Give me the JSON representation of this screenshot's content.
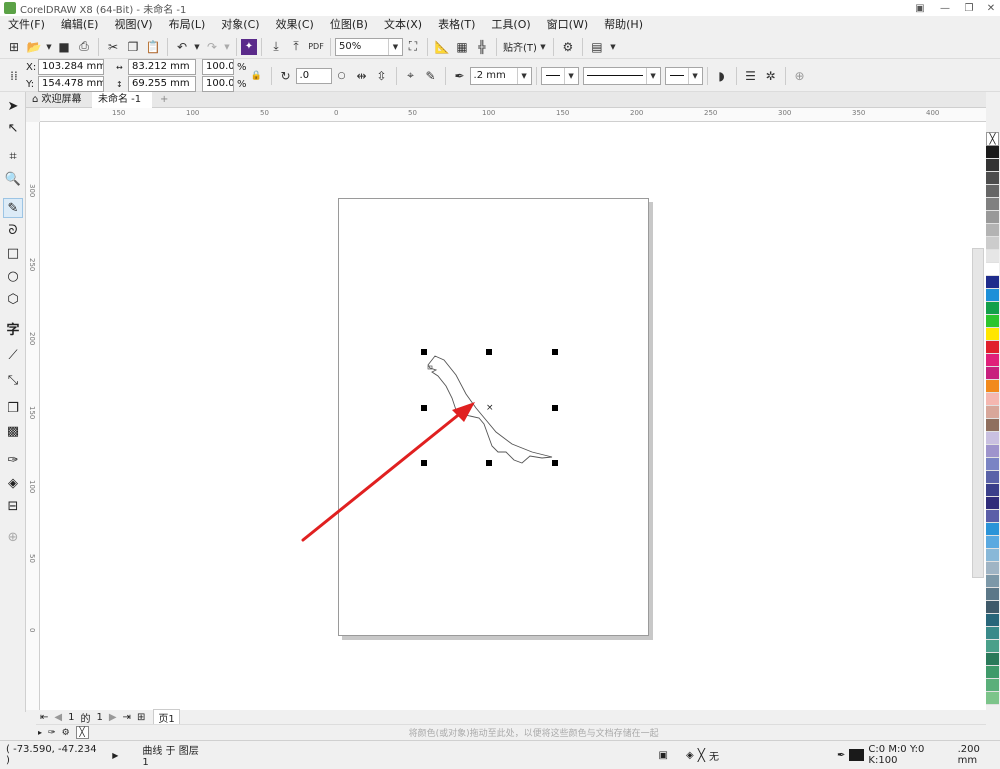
{
  "window": {
    "title": "CorelDRAW X8 (64-Bit) - 未命名 -1",
    "minimize": "—",
    "restore": "❐",
    "close": "✕"
  },
  "menu": [
    "文件(F)",
    "编辑(E)",
    "视图(V)",
    "布局(L)",
    "对象(C)",
    "效果(C)",
    "位图(B)",
    "文本(X)",
    "表格(T)",
    "工具(O)",
    "窗口(W)",
    "帮助(H)"
  ],
  "standard_toolbar": {
    "zoom": "50%",
    "snap_label": "贴齐(T)"
  },
  "property_bar": {
    "x_label": "X:",
    "x": "103.284 mm",
    "y_label": "Y:",
    "y": "154.478 mm",
    "width": "83.212 mm",
    "height": "69.255 mm",
    "scale_x": "100.0",
    "scale_y": "100.0",
    "percent": "%",
    "rotation": ".0",
    "outline_width": ".2 mm"
  },
  "tabs": {
    "welcome": "欢迎屏幕",
    "document": "未命名 -1",
    "add": "+"
  },
  "rulers": {
    "horizontal": [
      "150",
      "100",
      "50",
      "0",
      "50",
      "100",
      "150",
      "200",
      "250",
      "300",
      "350",
      "400"
    ],
    "vertical": [
      "300",
      "250",
      "200",
      "150",
      "100",
      "50",
      "0"
    ]
  },
  "page_nav": {
    "current": "1",
    "of": "的",
    "total": "1",
    "page_tab": "页1"
  },
  "color_hint": "将颜色(或对象)拖动至此处，以便将这些颜色与文档存储在一起",
  "status": {
    "coords": "( -73.590, -47.234 )",
    "object_info": "曲线 于 图层 1",
    "fill_none": "无",
    "outline_color": "C:0 M:0 Y:0 K:100",
    "outline_width": ".200 mm"
  },
  "colors": {
    "accent_red": "#e02020",
    "palette": [
      "#1a1a1a",
      "#333333",
      "#4d4d4d",
      "#666666",
      "#808080",
      "#999999",
      "#b3b3b3",
      "#cccccc",
      "#e6e6e6",
      "#ffffff",
      "#1f2c8c",
      "#1e90d8",
      "#13a04a",
      "#2dc52d",
      "#ffe600",
      "#e0202c",
      "#e0207a",
      "#c8207e",
      "#f28a1c",
      "#f5b7b0",
      "#d8a79a",
      "#8f6f5e",
      "#c9c0e0",
      "#9e94cc",
      "#7a84c4",
      "#5a62a8",
      "#3a3f8a",
      "#2f2c7a",
      "#5b5ea8",
      "#2b94d8",
      "#5aa9e0",
      "#88b8d8",
      "#9fb4c4",
      "#7c98a8",
      "#5c7888",
      "#3f5a6a",
      "#28667a",
      "#3a8a8a",
      "#4aa08a",
      "#2a7a5a",
      "#3f9a6a",
      "#5aaf7a",
      "#7cc48a"
    ]
  }
}
